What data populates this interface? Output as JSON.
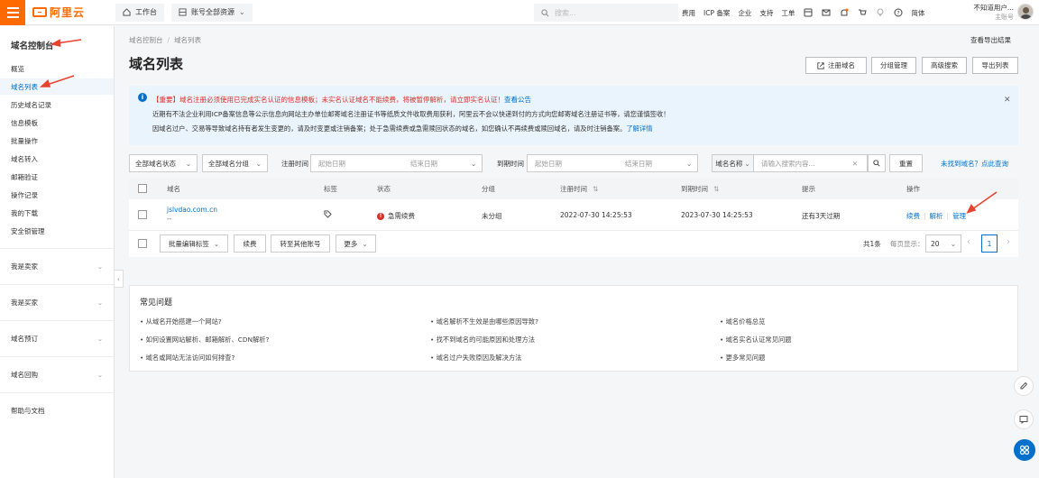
{
  "topbar": {
    "logo_text": "阿里云",
    "workbench": "工作台",
    "resource_scope": "账号全部资源",
    "search_placeholder": "搜索...",
    "nav": [
      "费用",
      "ICP 备案",
      "企业",
      "支持",
      "工单"
    ],
    "language": "简体",
    "user_name": "不知道用户...",
    "user_role": "主账号"
  },
  "sidebar": {
    "title": "域名控制台",
    "items": [
      "概览",
      "域名列表",
      "历史域名记录",
      "信息模板",
      "批量操作",
      "域名转入",
      "邮箱验证",
      "操作记录",
      "我的下载",
      "安全锁管理"
    ],
    "active_index": 1,
    "groups": [
      "我是卖家",
      "我是买家",
      "域名预订",
      "域名回购"
    ],
    "help": "帮助与文档"
  },
  "breadcrumb": [
    "域名控制台",
    "域名列表"
  ],
  "export_results": "查看导出结果",
  "page_title": "域名列表",
  "header_buttons": [
    "注册域名",
    "分组管理",
    "高级搜索",
    "导出列表"
  ],
  "notice": {
    "important": "【重要】域名注册必须使用已完成实名认证的信息模板；未实名认证域名不能续费，将被暂停解析，请立即实名认证！",
    "important_link": "查看公告",
    "line2": "近期有不法企业利用ICP备案信息等公示信息向网站主办单位邮寄域名注册证书等纸质文件收取费用获利，阿里云不会以快递到付的方式向您邮寄域名注册证书等，请您谨慎签收！",
    "line3": "因域名过户、交易等导致域名持有者发生变更的，请及时变更或注销备案；处于急需续费或急需赎回状态的域名，如您确认不再续费或赎回域名，请及时注销备案。",
    "line3_link": "了解详情"
  },
  "filters": {
    "status": "全部域名状态",
    "group": "全部域名分组",
    "reg_time_label": "注册时间",
    "exp_time_label": "到期时间",
    "start_date": "起始日期",
    "end_date": "结束日期",
    "search_field": "域名名称",
    "search_placeholder": "请输入搜索内容...",
    "reset": "重置",
    "not_found": "未找到域名？点此查询"
  },
  "table": {
    "headers": [
      "域名",
      "标签",
      "状态",
      "分组",
      "注册时间",
      "到期时间",
      "提示",
      "操作"
    ],
    "rows": [
      {
        "domain": "jslvdao.com.cn",
        "sub": "--",
        "status": "急需续费",
        "group": "未分组",
        "reg_time": "2022-07-30 14:25:53",
        "exp_time": "2023-07-30 14:25:53",
        "tip": "还有3天过期",
        "actions": [
          "续费",
          "解析",
          "管理"
        ]
      }
    ],
    "footer_buttons": [
      "批量编辑标签",
      "续费",
      "转至其他账号",
      "更多"
    ],
    "total": "共1条",
    "page_size_label": "每页显示：",
    "page_size": "20",
    "current_page": "1"
  },
  "faq": {
    "title": "常见问题",
    "items": [
      "从域名开始搭建一个网站?",
      "域名解析不生效是由哪些原因导致?",
      "域名价格总览",
      "如何设置网站解析、邮箱解析、CDN解析?",
      "找不到域名的可能原因和处理方法",
      "域名实名认证常见问题",
      "域名或网站无法访问如何排查?",
      "域名过户失败原因及解决方法",
      "更多常见问题"
    ]
  },
  "colors": {
    "brand": "#ff6a00",
    "link": "#0070cc",
    "danger": "#d93026",
    "annotation": "#e8432e"
  }
}
